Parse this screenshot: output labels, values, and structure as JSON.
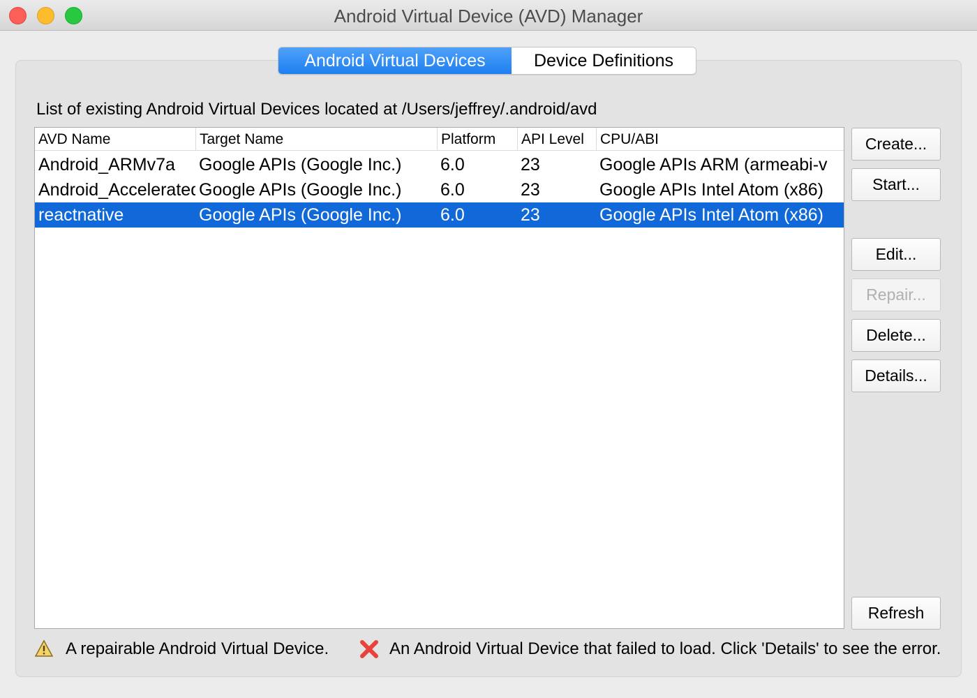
{
  "window": {
    "title": "Android Virtual Device (AVD) Manager"
  },
  "tabs": [
    {
      "label": "Android Virtual Devices",
      "active": true
    },
    {
      "label": "Device Definitions",
      "active": false
    }
  ],
  "avd_list": {
    "path_label": "List of existing Android Virtual Devices located at /Users/jeffrey/.android/avd",
    "columns": [
      "AVD Name",
      "Target Name",
      "Platform",
      "API Level",
      "CPU/ABI"
    ],
    "rows": [
      [
        "Android_ARMv7a",
        "Google APIs (Google Inc.)",
        "6.0",
        "23",
        "Google APIs ARM (armeabi-v"
      ],
      [
        "Android_Accelerated",
        "Google APIs (Google Inc.)",
        "6.0",
        "23",
        "Google APIs Intel Atom (x86)"
      ],
      [
        "reactnative",
        "Google APIs (Google Inc.)",
        "6.0",
        "23",
        "Google APIs Intel Atom (x86)"
      ]
    ],
    "selected_row": 2
  },
  "buttons": {
    "create": "Create...",
    "start": "Start...",
    "edit": "Edit...",
    "repair": "Repair...",
    "delete": "Delete...",
    "details": "Details...",
    "refresh": "Refresh"
  },
  "legend": {
    "repairable": "A repairable Android Virtual Device.",
    "failed": "An Android Virtual Device that failed to load. Click 'Details' to see the error."
  },
  "colors": {
    "selection": "#1169d9",
    "tab_active": "#2b8cf4",
    "error_icon": "#e8423b",
    "warning_icon": "#e0b43c"
  }
}
